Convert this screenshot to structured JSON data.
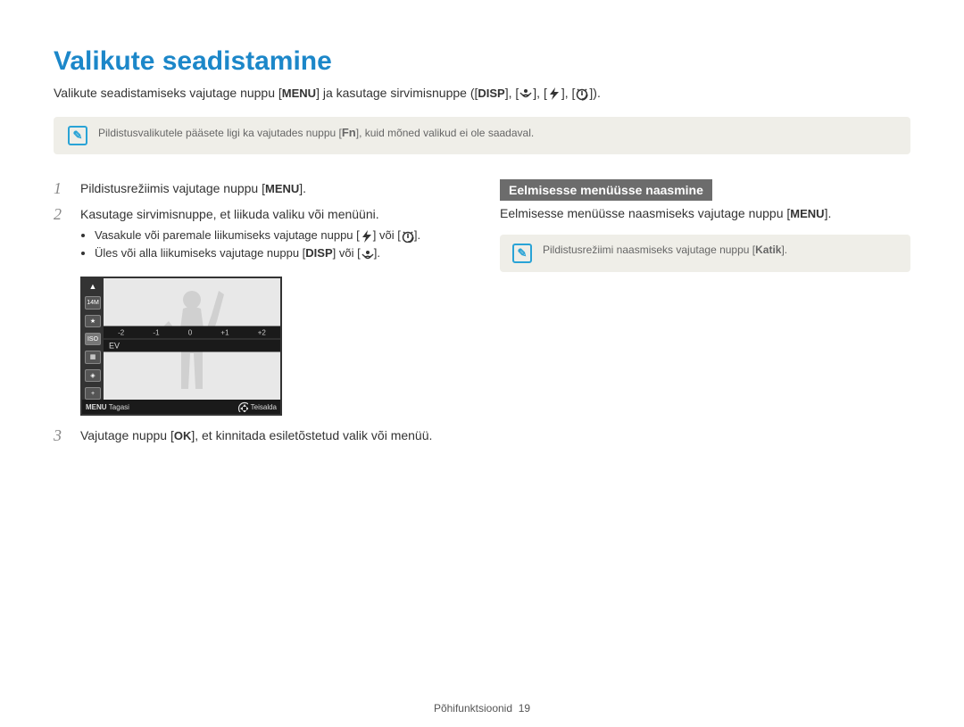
{
  "title": "Valikute seadistamine",
  "intro_before": "Valikute seadistamiseks vajutage nuppu [",
  "intro_after_menu": "] ja kasutage sirvimisnuppe ([",
  "intro_end": "]).",
  "menu_label": "MENU",
  "disp_label": "DISP",
  "fn_label": "Fn",
  "ok_label": "OK",
  "note1_before": "Pildistusvalikutele pääsete ligi ka vajutades nuppu [",
  "note1_after": "], kuid mõned valikud ei ole saadaval.",
  "left": {
    "steps": {
      "1": {
        "num": "1",
        "text_before": "Pildistusrežiimis vajutage nuppu [",
        "text_after": "]."
      },
      "2": {
        "num": "2",
        "text": "Kasutage sirvimisnuppe, et liikuda valiku või menüüni.",
        "b1_before": "Vasakule või paremale liikumiseks vajutage nuppu [",
        "b1_mid": "] või [",
        "b1_after": "].",
        "b2_before": "Üles või alla liikumiseks vajutage nuppu [",
        "b2_mid": "] või [",
        "b2_after": "]."
      },
      "3": {
        "num": "3",
        "text_before": "Vajutage nuppu [",
        "text_after": "], et kinnitada esiletõstetud valik või menüü."
      }
    }
  },
  "cam": {
    "ev_ticks": [
      "-2",
      "-1",
      "0",
      "+1",
      "+2"
    ],
    "ev_label": "EV",
    "side": [
      "14M",
      "★",
      "ISO",
      "▦",
      "◈",
      "+"
    ],
    "footer_back": "Tagasi",
    "footer_move": "Teisalda",
    "footer_menu": "MENU"
  },
  "right": {
    "header": "Eelmisesse menüüsse naasmine",
    "text_before": "Eelmisesse menüüsse naasmiseks vajutage nuppu [",
    "text_after": "].",
    "note_before": "Pildistusrežiimi naasmiseks vajutage nuppu [",
    "note_bold": "Katik",
    "note_after": "]."
  },
  "footer": {
    "label": "Põhifunktsioonid",
    "page": "19"
  }
}
